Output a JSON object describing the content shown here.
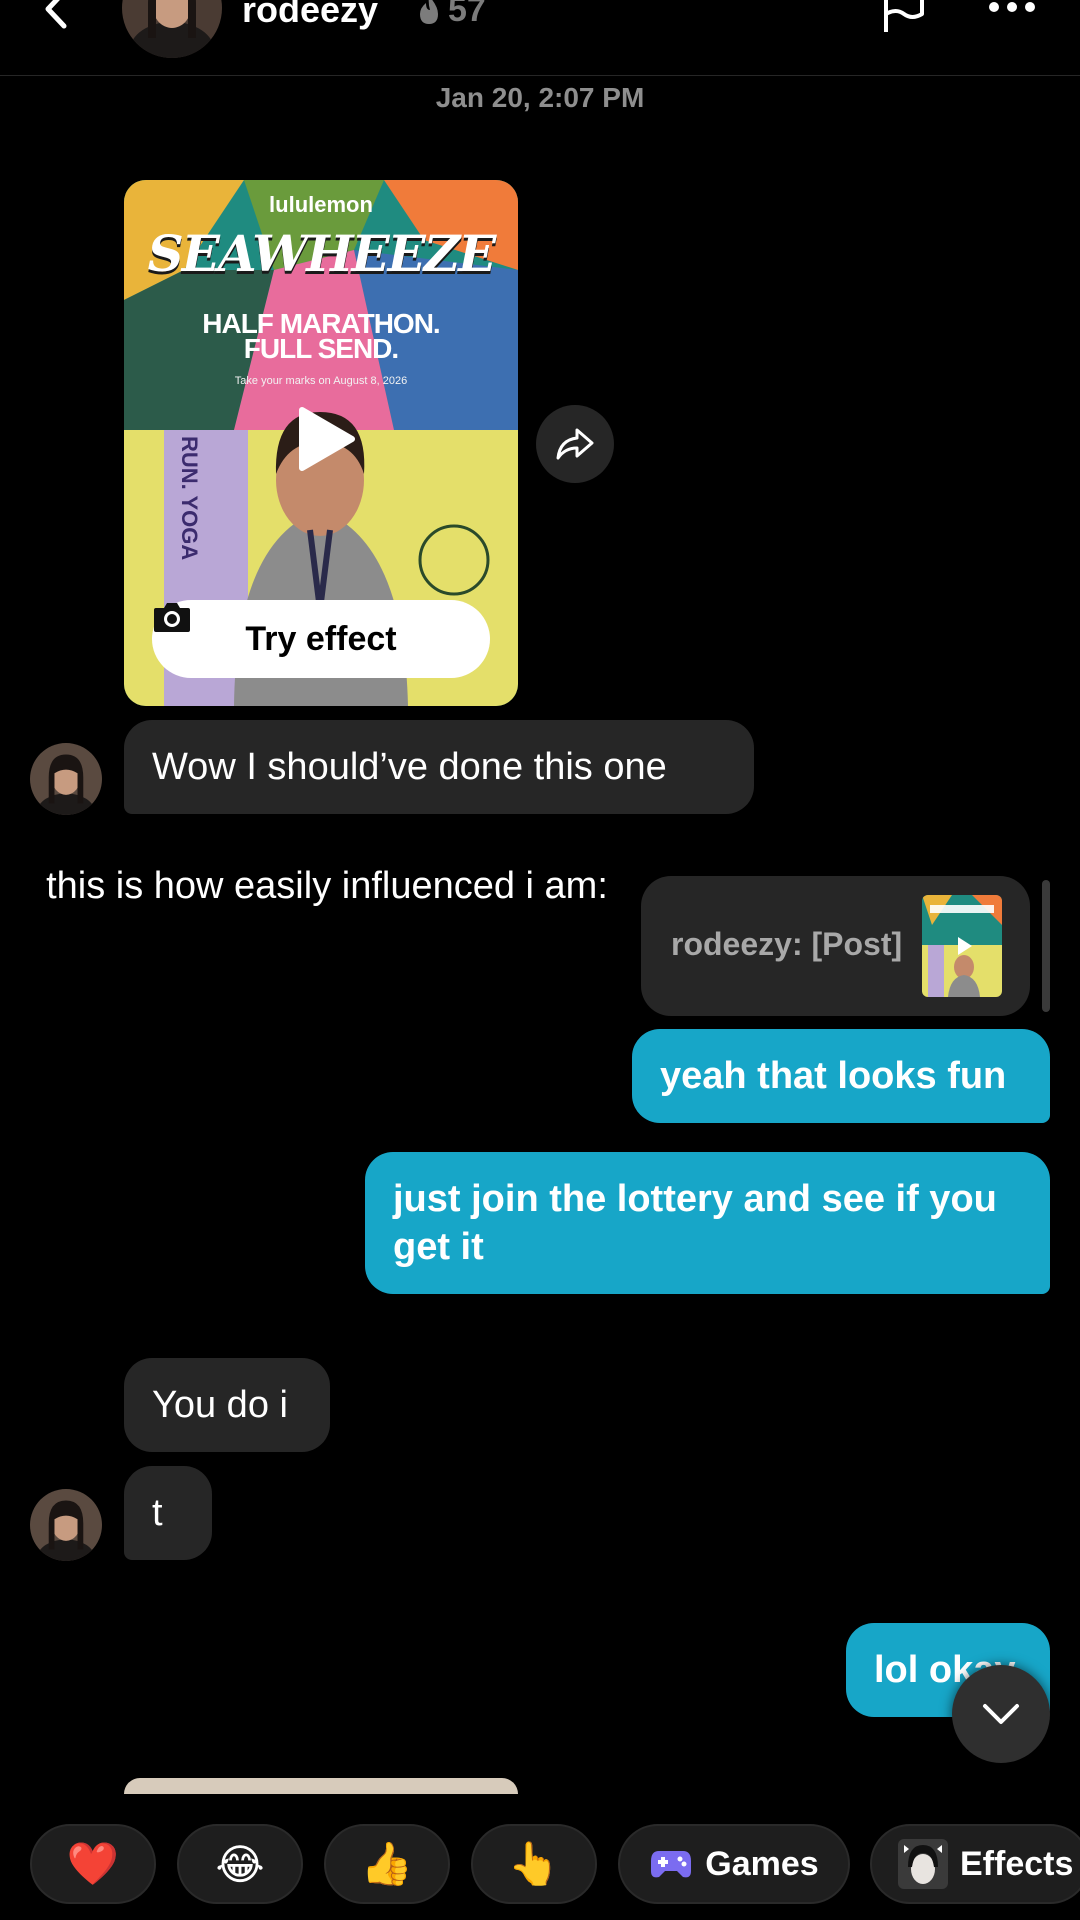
{
  "header": {
    "username": "rodeezy",
    "streak_count": "57"
  },
  "timestamp": "Jan 20, 2:07 PM",
  "shared_post": {
    "brand": "lululemon",
    "title": "SEAWHEEZE",
    "headline_line1": "HALF MARATHON.",
    "headline_line2": "FULL SEND.",
    "caption": "Take your marks on August 8, 2026",
    "side_text": "RUN. YOGA",
    "try_effect_label": "Try effect"
  },
  "overlay_caption": "this is how easily influenced i am:",
  "reply_preview": {
    "label": "rodeezy: [Post]"
  },
  "messages": [
    {
      "from": "them",
      "text": "Wow I should’ve done this one"
    },
    {
      "from": "me",
      "text": "yeah that looks fun"
    },
    {
      "from": "me",
      "text": "just join the lottery and see if you get it"
    },
    {
      "from": "them",
      "text": "You do i"
    },
    {
      "from": "them",
      "text": "t"
    },
    {
      "from": "me",
      "text": "lol okay"
    }
  ],
  "quick_bar": {
    "heart": "❤️",
    "laugh": "😂",
    "thumbs_up": "👍",
    "point": "👆",
    "games_label": "Games",
    "effects_label": "Effects"
  },
  "colors": {
    "background": "#000000",
    "incoming_bubble": "#262626",
    "outgoing_bubble": "#17a6c8",
    "timestamp": "#8e8e8e"
  }
}
